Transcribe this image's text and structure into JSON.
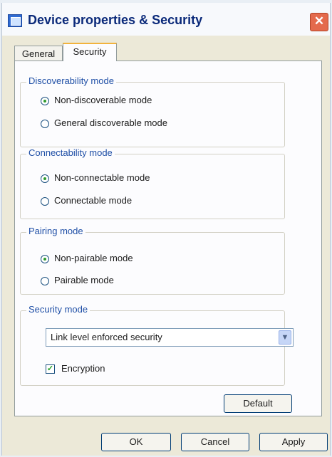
{
  "window": {
    "title": "Device properties & Security",
    "close_symbol": "✕"
  },
  "tabs": [
    {
      "label": "General",
      "selected": false
    },
    {
      "label": "Security",
      "selected": true
    }
  ],
  "groups": {
    "discoverability": {
      "label": "Discoverability mode",
      "options": [
        {
          "label": "Non-discoverable mode",
          "selected": true
        },
        {
          "label": "General discoverable mode",
          "selected": false
        }
      ]
    },
    "connectability": {
      "label": "Connectability mode",
      "options": [
        {
          "label": "Non-connectable mode",
          "selected": true
        },
        {
          "label": "Connectable mode",
          "selected": false
        }
      ]
    },
    "pairing": {
      "label": "Pairing mode",
      "options": [
        {
          "label": "Non-pairable mode",
          "selected": true
        },
        {
          "label": "Pairable mode",
          "selected": false
        }
      ]
    },
    "security": {
      "label": "Security mode",
      "select_value": "Link level enforced security",
      "encryption_label": "Encryption",
      "encryption_checked": true
    }
  },
  "buttons": {
    "default": "Default",
    "ok": "OK",
    "cancel": "Cancel",
    "apply": "Apply"
  },
  "icons": {
    "window_icon": "device-icon",
    "close_icon": "close-icon",
    "dropdown_icon": "chevron-down-icon",
    "check_mark": "✓"
  }
}
